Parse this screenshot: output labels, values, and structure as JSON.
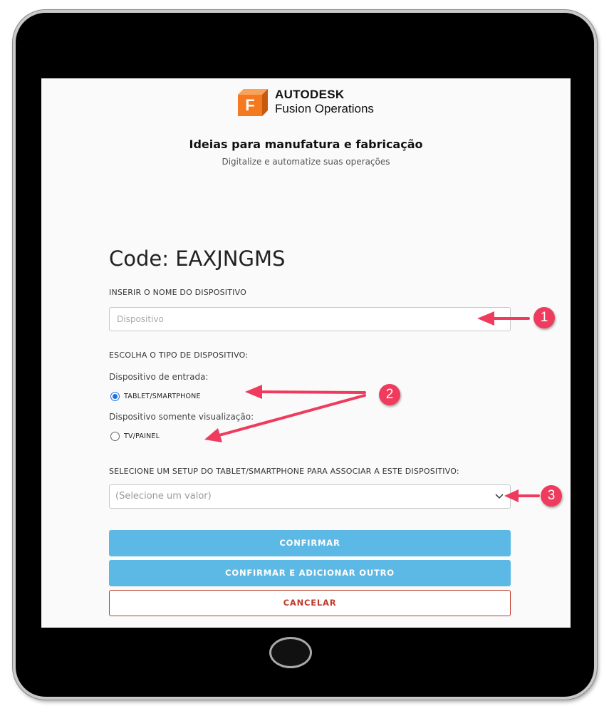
{
  "brand": {
    "logo_letter": "F",
    "line1": "AUTODESK",
    "line2": "Fusion Operations",
    "accent": "#f47920"
  },
  "header": {
    "title": "Ideias para manufatura e fabricação",
    "subtitle": "Digitalize e automatize suas operações"
  },
  "form": {
    "code": "Code: EAXJNGMS",
    "device_name_label": "INSERIR O NOME DO DISPOSITIVO",
    "device_name_placeholder": "Dispositivo",
    "device_name_value": "",
    "device_type_label": "ESCOLHA O TIPO DE DISPOSITIVO:",
    "input_group_label": "Dispositivo de entrada:",
    "option_tablet": "TABLET/SMARTPHONE",
    "view_group_label": "Dispositivo somente visualização:",
    "option_tv": "TV/PAINEL",
    "selected_device_type": "TABLET/SMARTPHONE",
    "setup_label": "SELECIONE UM SETUP DO TABLET/SMARTPHONE PARA ASSOCIAR A ESTE DISPOSITIVO:",
    "setup_placeholder": "(Selecione um valor)"
  },
  "buttons": {
    "confirm": "CONFIRMAR",
    "confirm_add": "CONFIRMAR E ADICIONAR OUTRO",
    "cancel": "CANCELAR"
  },
  "callouts": [
    "1",
    "2",
    "3"
  ],
  "colors": {
    "primary_button": "#5cb9e5",
    "cancel": "#c0392b",
    "radio_selected": "#1a73e8",
    "callout": "#ef3b5d"
  }
}
